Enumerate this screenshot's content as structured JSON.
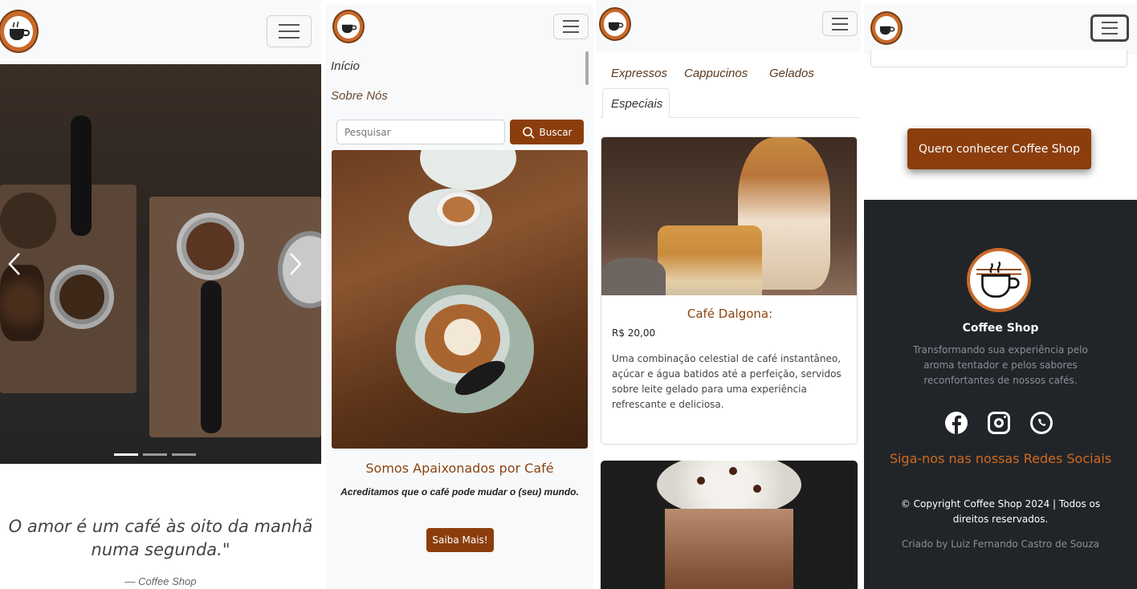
{
  "colors": {
    "brand": "#8b3e0c",
    "brand_text": "#8b4513",
    "footer_bg": "#212529",
    "nav_bg": "#f8f9fa"
  },
  "panel1": {
    "logo_icon": "coffee-cup-logo-icon",
    "menu_icon": "hamburger-icon",
    "carousel": {
      "prev_icon": "chevron-left-icon",
      "next_icon": "chevron-right-icon",
      "indicator_count": 3,
      "active_index": 0
    },
    "quote": "O amor é um café às oito da manhã numa segunda.\"",
    "quote_author": "—  Coffee Shop"
  },
  "panel2": {
    "nav_items": [
      "Início",
      "Sobre Nós"
    ],
    "search_placeholder": "Pesquisar",
    "search_button": "Buscar",
    "about_title": "Somos Apaixonados por Café",
    "about_subtitle": "Acreditamos que o café pode mudar o (seu) mundo.",
    "about_button": "Saiba Mais!"
  },
  "panel3": {
    "tabs": [
      "Expressos",
      "Cappucinos",
      "Gelados",
      "Especiais"
    ],
    "active_tab": "Especiais",
    "card": {
      "title": "Café Dalgona:",
      "price": "R$ 20,00",
      "description": "Uma combinação celestial de café instantâneo, açúcar e água batidos até a perfeição, servidos sobre leite gelado para uma experiência refrescante e deliciosa."
    }
  },
  "panel4": {
    "cta_button": "Quero conhecer Coffee Shop",
    "footer": {
      "brand": "Coffee Shop",
      "tagline": "Transformando sua experiência pelo aroma tentador e pelos sabores reconfortantes de nossos cafés.",
      "social_icons": [
        "facebook-icon",
        "instagram-icon",
        "whatsapp-icon"
      ],
      "social_heading": "Siga-nos nas nossas Redes Sociais",
      "copyright": "© Copyright Coffee Shop 2024 | Todos os direitos reservados.",
      "credit": "Criado by Luiz Fernando Castro de Souza"
    }
  }
}
